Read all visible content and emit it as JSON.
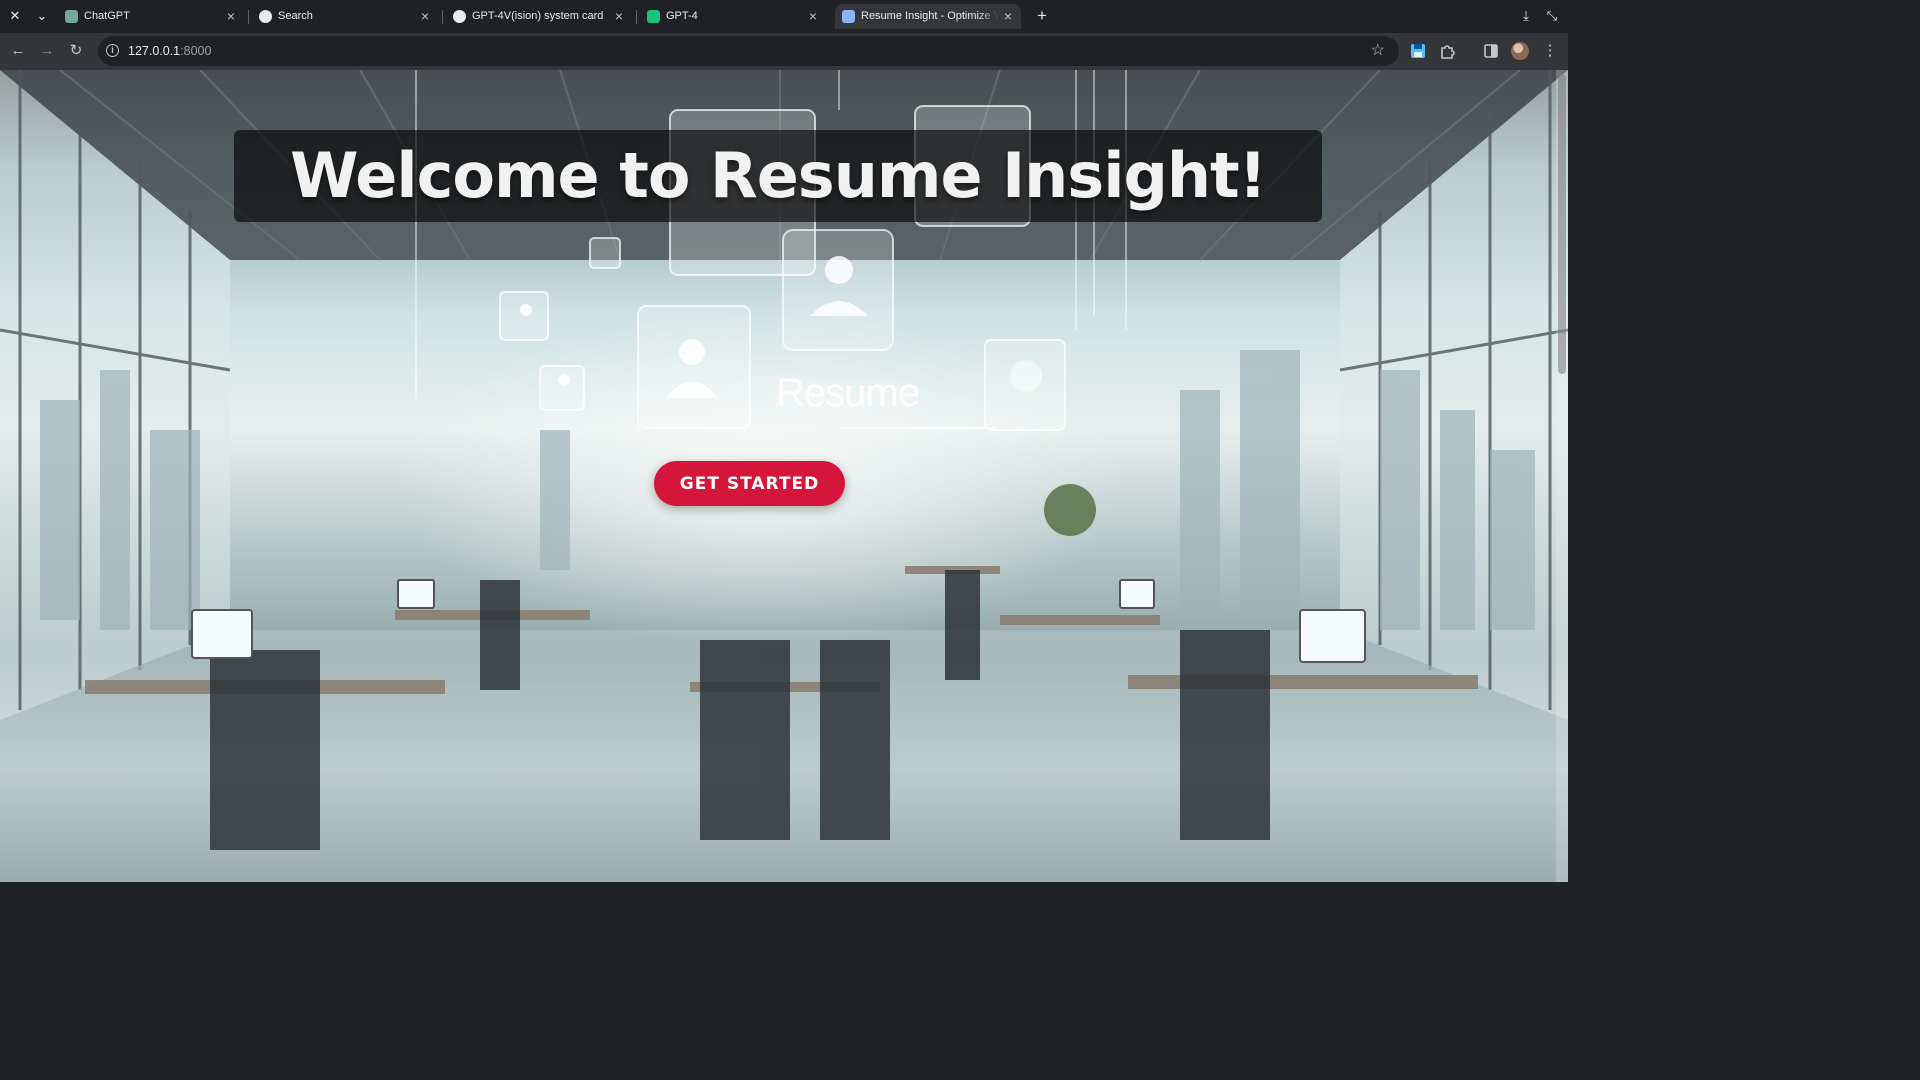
{
  "browser": {
    "tabs": [
      {
        "title": "ChatGPT",
        "favicon": "chatgpt-icon",
        "favicon_color": "#74aa9c",
        "active": false
      },
      {
        "title": "Search",
        "favicon": "openai-icon",
        "favicon_color": "#e8eaed",
        "active": false
      },
      {
        "title": "GPT-4V(ision) system card",
        "favicon": "openai-icon",
        "favicon_color": "#e8eaed",
        "active": false
      },
      {
        "title": "GPT-4",
        "favicon": "chatgpt-icon",
        "favicon_color": "#19c37d",
        "active": false
      },
      {
        "title": "Resume Insight - Optimize Your Resume",
        "favicon": "page-icon",
        "favicon_color": "#8ab4f8",
        "active": true
      }
    ],
    "address": {
      "host": "127.0.0.1",
      "port": ":8000"
    }
  },
  "hero": {
    "title": "Welcome to Resume Insight!",
    "image_text": "Resume",
    "cta_label": "GET STARTED"
  },
  "colors": {
    "cta": "#d4163a",
    "chrome_dark": "#202124",
    "chrome_toolbar": "#35363a"
  }
}
